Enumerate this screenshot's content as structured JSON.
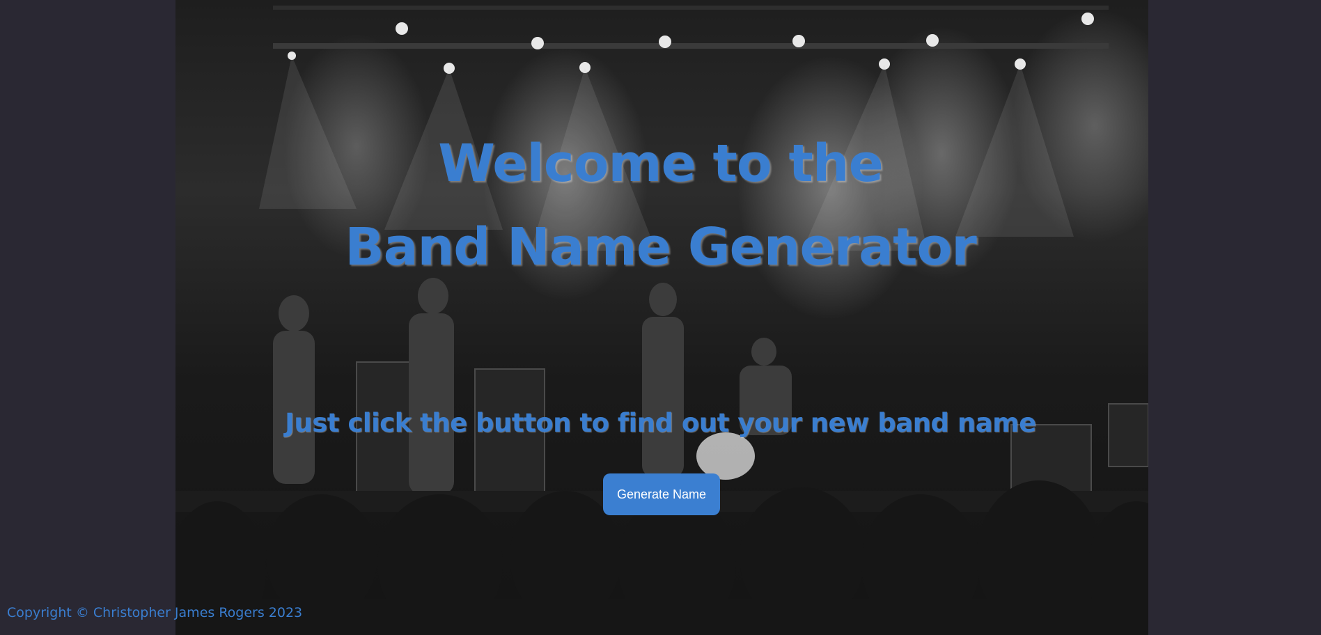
{
  "hero": {
    "title_line1": "Welcome to the",
    "title_line2": "Band Name Generator",
    "subtitle": "Just click the button to find out your new band name"
  },
  "actions": {
    "generate_label": "Generate Name"
  },
  "footer": {
    "copyright": "Copyright © Christopher James Rogers 2023"
  },
  "background": {
    "description_icon": "concert-stage-photo"
  },
  "colors": {
    "page_background": "#2a2833",
    "accent": "#3a7ed0",
    "button_background": "#3b7fd1",
    "button_text": "#ffffff"
  }
}
